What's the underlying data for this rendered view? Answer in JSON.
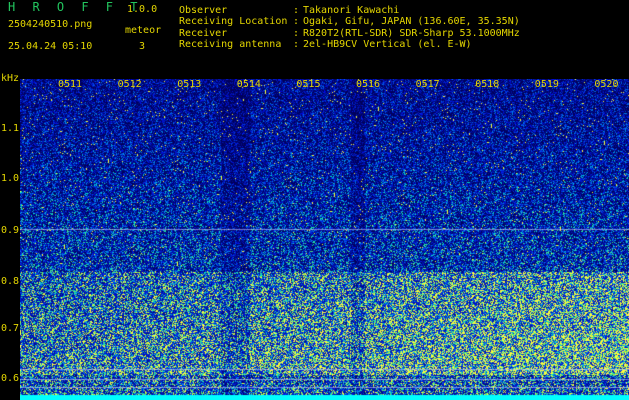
{
  "app": {
    "name": "H R O F F T",
    "version": "1.0.0"
  },
  "file": {
    "name": "2504240510.png",
    "datetime": "25.04.24 05:10"
  },
  "meteor": {
    "label": "meteor",
    "count": "3"
  },
  "meta": [
    {
      "label": "Observer",
      "value": "Takanori Kawachi"
    },
    {
      "label": "Receiving Location",
      "value": "Ogaki, Gifu, JAPAN (136.60E, 35.35N)"
    },
    {
      "label": "Receiver",
      "value": "R820T2(RTL-SDR) SDR-Sharp 53.1000MHz"
    },
    {
      "label": "Receiving antenna",
      "value": "2el-HB9CV Vertical (el. E-W)"
    }
  ],
  "axis": {
    "y_unit": "kHz",
    "x_ticks": [
      "0511",
      "0512",
      "0513",
      "0514",
      "0515",
      "0516",
      "0517",
      "0518",
      "0519",
      "0520"
    ],
    "y_ticks": [
      "1.1",
      "1.0",
      "0.9",
      "0.8",
      "0.7",
      "0.6"
    ]
  },
  "colors": {
    "label": "#e5d700",
    "title": "#22c55e",
    "background": "#000000",
    "spectrum_low": "#0a1a8a",
    "spectrum_high": "#ffff40"
  }
}
